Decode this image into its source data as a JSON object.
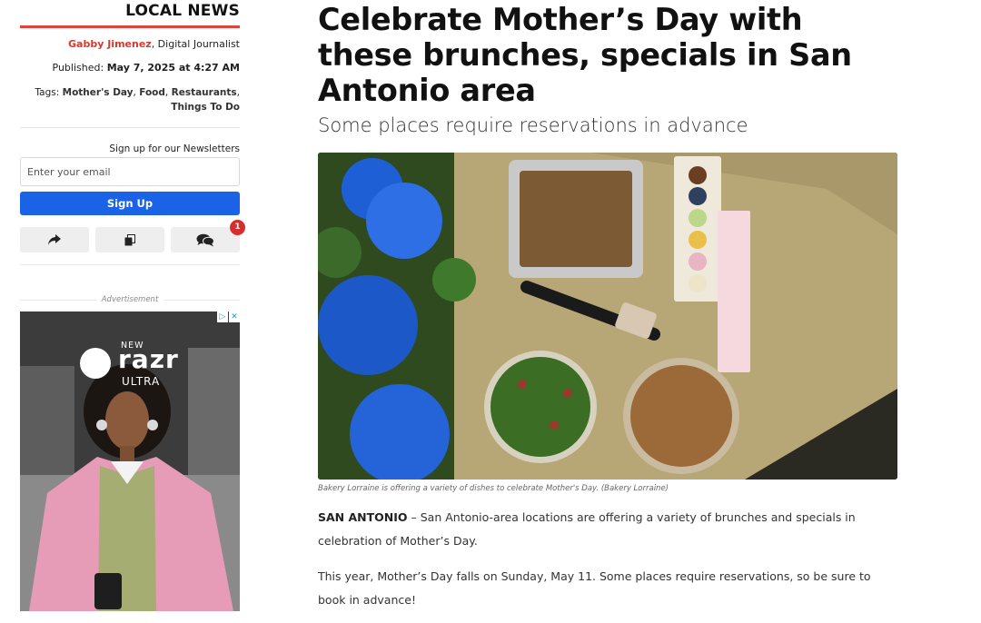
{
  "sidebar": {
    "section_title": "LOCAL NEWS",
    "author_name": "Gabby Jimenez",
    "author_role": ", Digital Journalist",
    "published_label": "Published: ",
    "published_value": "May 7, 2025 at 4:27 AM",
    "tags_label": "Tags: ",
    "tags": [
      "Mother's Day",
      "Food",
      "Restaurants",
      "Things To Do"
    ],
    "newsletter_label": "Sign up for our Newsletters",
    "email_placeholder": "Enter your email",
    "signup_label": "Sign Up",
    "share_icons": [
      "share-icon",
      "copy-icon",
      "comments-icon"
    ],
    "comments_count": "1",
    "ad_label": "Advertisement",
    "ad": {
      "new_label": "NEW",
      "brand": "razr",
      "model": "ULTRA",
      "close_glyphs": [
        "▷",
        "✕"
      ]
    }
  },
  "article": {
    "headline": "Celebrate Mother’s Day with these brunches, specials in San Antonio area",
    "subheadline": "Some places require reservations in advance",
    "image_caption": "Bakery Lorraine is offering a variety of dishes to celebrate Mother's Day. (Bakery Lorraine)",
    "dateline": "SAN ANTONIO",
    "para1": " – San Antonio-area locations are offering a variety of brunches and specials in celebration of Mother’s Day.",
    "para2": "This year, Mother’s Day falls on Sunday, May 11. Some places require reservations, so be sure to book in advance!"
  },
  "colors": {
    "accent_red": "#e0443b",
    "signup_blue": "#1a63e6",
    "badge_red": "#d42f2f"
  }
}
